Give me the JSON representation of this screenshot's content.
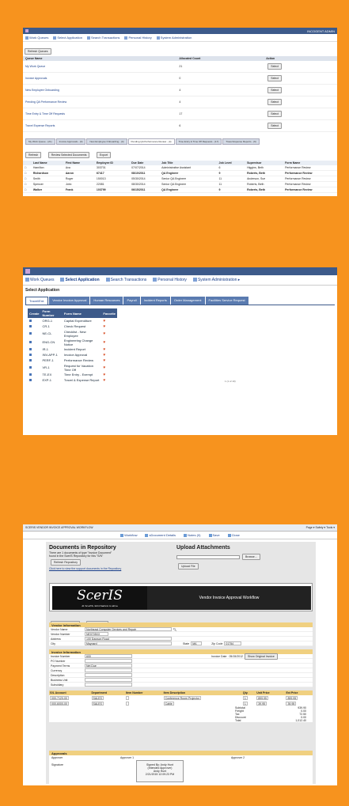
{
  "p1": {
    "topbar_right": "INCOGENT ADMIN",
    "menu": [
      "Work Queues",
      "Select Application",
      "Search Transactions",
      "Personal History",
      "System Administration"
    ],
    "refresh": "Refresh Queues",
    "queue_headers": [
      "Queue Name",
      "Allocated Count",
      "Action"
    ],
    "queues": [
      {
        "name": "My Work Queue",
        "count": "21",
        "action": "Select"
      },
      {
        "name": "Invoice Approvals",
        "count": "0",
        "action": "Select"
      },
      {
        "name": "New Employee Onboarding",
        "count": "4",
        "action": "Select"
      },
      {
        "name": "Pending QA Performance Review",
        "count": "4",
        "action": "Select"
      },
      {
        "name": "Time Entry & Time Off Requests",
        "count": "17",
        "action": "Select"
      },
      {
        "name": "Travel Expense Reports",
        "count": "6",
        "action": "Select"
      }
    ],
    "tabs": [
      "My Work Queue - (21)",
      "Invoice Approvals - (0)",
      "New Employee Onboarding - (4)",
      "Pending QA Performance Review - (4)",
      "Time Entry & Time Off Requests - (17)",
      "Travel Expense Reports - (6)"
    ],
    "buttons": [
      "Refresh",
      "Review Selected Documents",
      "Export"
    ],
    "headers": [
      "",
      "Last Name",
      "First Name",
      "Employee ID",
      "Due Date",
      "Job Title",
      "Job Level",
      "Supervisor",
      "Form Name"
    ],
    "rows": [
      {
        "last": "Hamilton",
        "first": "Ava",
        "id": "303701",
        "due": "07/07/2014",
        "title": "Administrative Assistant",
        "level": "6",
        "sup": "Higgins, Beth",
        "form": "Performance Review",
        "bold": false
      },
      {
        "last": "Richardson",
        "first": "Aaron",
        "id": "67417",
        "due": "08/10/2011",
        "title": "QA Engineer",
        "level": "9",
        "sup": "Roberts, Beth",
        "form": "Performance Review",
        "bold": true
      },
      {
        "last": "Smith",
        "first": "Roger",
        "id": "150013",
        "due": "05/30/2014",
        "title": "Senior QA Engineer",
        "level": "11",
        "sup": "Anderson, Sue",
        "form": "Performance Review",
        "bold": false
      },
      {
        "last": "Spencer",
        "first": "John",
        "id": "22081",
        "due": "08/30/2014",
        "title": "Senior QA Engineer",
        "level": "11",
        "sup": "Roberts, Beth",
        "form": "Performance Review",
        "bold": false
      },
      {
        "last": "Walker",
        "first": "Frank",
        "id": "103799",
        "due": "06/15/2011",
        "title": "QA Engineer",
        "level": "9",
        "sup": "Roberts, Beth",
        "form": "Performance Review",
        "bold": true
      }
    ]
  },
  "p2": {
    "menu": [
      "Work Queues",
      "Select Application",
      "Search Transactions",
      "Personal History",
      "System Administration ▸"
    ],
    "heading": "Select Application",
    "tabs": [
      "Travel/Ent.",
      "Vendor Invoice Approval",
      "Human Resources",
      "Payroll",
      "Incident Reports",
      "Order Management",
      "Facilities Service Request"
    ],
    "headers": [
      "Create",
      "Form Number",
      "Form Name",
      "Favorite"
    ],
    "forms": [
      {
        "num": "ORG-1",
        "name": "Capital Expenditure"
      },
      {
        "num": "CR-1",
        "name": "Check Request"
      },
      {
        "num": "NE-CL",
        "name": "Checklist - New Employee"
      },
      {
        "num": "ENG-CN",
        "name": "Engineering Change Notice"
      },
      {
        "num": "IR-1",
        "name": "Incident Report"
      },
      {
        "num": "INV-APP-1",
        "name": "Invoice Approval"
      },
      {
        "num": "PERF-1",
        "name": "Performance Review"
      },
      {
        "num": "VR-1",
        "name": "Request for Vacation Time Off"
      },
      {
        "num": "TE-EX",
        "name": "Time Entry - Exempt"
      },
      {
        "num": "EXP-1",
        "name": "Travel & Expense Report"
      }
    ],
    "page_note": "1 (1 of 10)"
  },
  "p3": {
    "browser_title": "SCERIS VENDOR INVOICE APPROVAL WORKFLOW",
    "browser_right": "Page ▾  Safety ▾  Tools ▾",
    "toolbar": [
      "Workflow",
      "sDocument Details",
      "Notes (0)",
      "Save",
      "Close"
    ],
    "repo_title": "Documents in Repository",
    "repo_sub1": "There are 1 documents of type \"Invoice Document\"",
    "repo_sub2": "found in the ScerIS Repository for this \"S/N\"",
    "repo_btn": "Refresh Repository",
    "repo_link": "Click here to view the support documents in the Repository",
    "attach_title": "Upload Attachments",
    "browse_btn": "Browse...",
    "upload_btn": "Upload File",
    "logo": "ScerIS",
    "logo_tag": "At ScerIS, information is alive",
    "header_title": "Vendor Invoice Approval Workflow",
    "route_buttons": [
      "Route for Approval",
      "Route to A/P"
    ],
    "vendor_section": "Vendor Information",
    "vendor": {
      "name_label": "Vendor Name",
      "name": "Northeast Computer Devices and Repair",
      "number_label": "Vendor Number",
      "number": "NE0705XX",
      "address_label": "Address",
      "address": "100 Dawson Road",
      "city_label": "City",
      "city": "Maynard",
      "state_label": "State",
      "state": "MA",
      "zip_label": "Zip Code",
      "zip": "01754"
    },
    "invoice_section": "Invoice Information",
    "invoice": {
      "number_label": "Invoice Number",
      "number": "600",
      "po_label": "PO Number",
      "terms_label": "Payment Terms",
      "terms": "Net Due",
      "currency_label": "Currency",
      "desc_label": "Description",
      "bu_label": "Business Unit",
      "sub_label": "Subsidiary",
      "date_label": "Invoice Date",
      "date": "05/15/2012",
      "show_btn": "Show Original Invoice"
    },
    "gl_headers": [
      "G/L Account",
      "Department",
      "Item Number",
      "Item Description",
      "Qty.",
      "Unit Price",
      "Ext Price"
    ],
    "gl_rows": [
      {
        "acct": "000-7120-00",
        "dept": "SALES",
        "item": "",
        "desc": "Conference Room Projector",
        "qty": "1",
        "unit": "899.95",
        "ext": "899.95"
      },
      {
        "acct": "000-6000-00",
        "dept": "SALES",
        "item": "",
        "desc": "Cable",
        "qty": "1",
        "unit": "39.95",
        "ext": "39.95"
      }
    ],
    "totals": [
      [
        "Subtotal",
        "939.90"
      ],
      [
        "Freight",
        "0.00"
      ],
      [
        "Tax",
        "72.50"
      ],
      [
        "Discount",
        "0.00"
      ],
      [
        "Total",
        "1,012.40"
      ]
    ],
    "approvals_section": "Approvals",
    "approver": "Approver",
    "approver1": "Approver 1",
    "approver2": "Approver 2",
    "signature": "Signature",
    "sig_lines": [
      "Signed By: Andy Hunt",
      "(Intended Approver)",
      "Andy Hunt",
      "2/21/2015 12:09:23 PM"
    ]
  }
}
